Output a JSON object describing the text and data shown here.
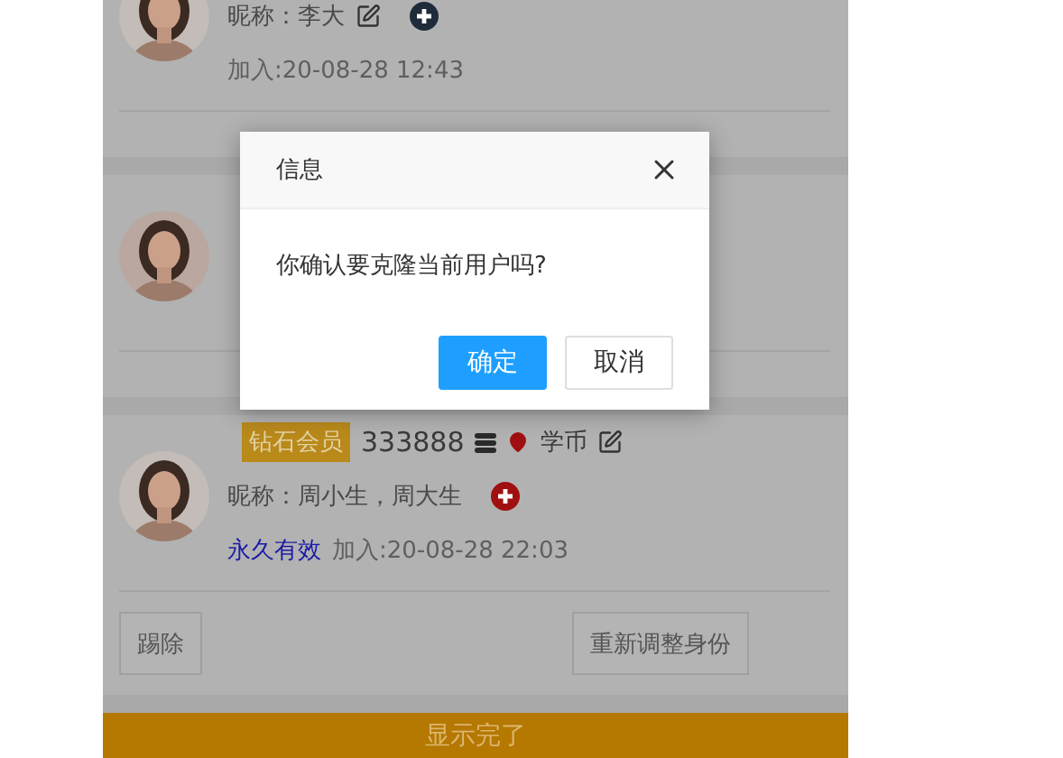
{
  "members": [
    {
      "kind": "full",
      "nickname": "昵称：李大",
      "nickname_edit_icon": true,
      "add_icon_alert": false,
      "joined": "加入:20-08-28 12:43"
    },
    {
      "kind": "covered"
    },
    {
      "kind": "full",
      "header": {
        "level": "钻石会员",
        "id": "333888",
        "currency": "学币"
      },
      "nickname": "昵称：周小生，周大生",
      "nickname_edit_icon": false,
      "add_icon_alert": true,
      "validity": "永久有效",
      "joined": "加入:20-08-28 22:03",
      "actions": [
        "踢除",
        "重新调整身份"
      ]
    }
  ],
  "footer": "显示完了",
  "dialog": {
    "title": "信息",
    "message": "你确认要克隆当前用户吗?",
    "buttons": [
      {
        "label": "确定",
        "kind": "primary"
      },
      {
        "label": "取消",
        "kind": "secondary"
      }
    ]
  }
}
